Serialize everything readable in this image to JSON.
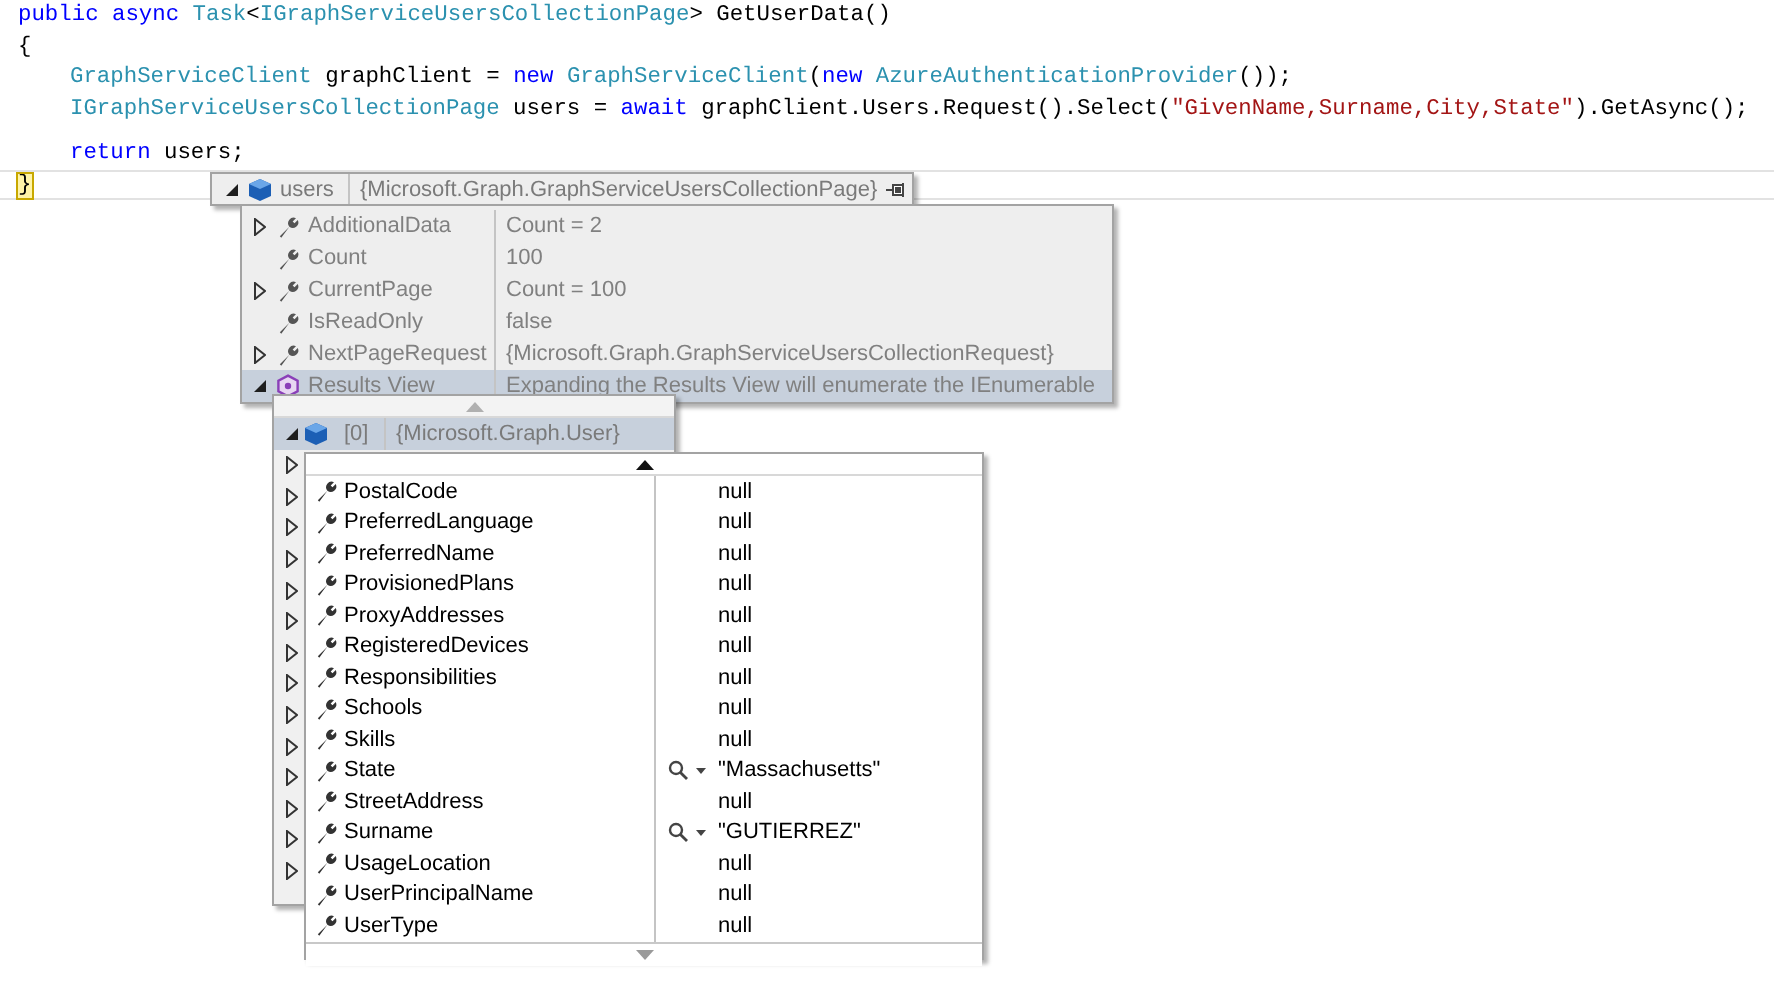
{
  "code": {
    "lines": [
      {
        "kind": "code",
        "indent": false,
        "current": false,
        "tokens": [
          {
            "kind": "keyword",
            "text": "public async "
          },
          {
            "kind": "type",
            "text": "Task"
          },
          {
            "kind": "plain",
            "text": "<"
          },
          {
            "kind": "type",
            "text": "IGraphServiceUsersCollectionPage"
          },
          {
            "kind": "plain",
            "text": "> GetUserData()"
          }
        ]
      },
      {
        "kind": "code",
        "indent": false,
        "current": false,
        "tokens": [
          {
            "kind": "plain",
            "text": "{"
          }
        ]
      },
      {
        "kind": "code",
        "indent": true,
        "current": false,
        "tokens": [
          {
            "kind": "type",
            "text": "GraphServiceClient"
          },
          {
            "kind": "plain",
            "text": " graphClient = "
          },
          {
            "kind": "keyword",
            "text": "new "
          },
          {
            "kind": "type",
            "text": "GraphServiceClient"
          },
          {
            "kind": "plain",
            "text": "("
          },
          {
            "kind": "keyword",
            "text": "new "
          },
          {
            "kind": "type",
            "text": "AzureAuthenticationProvider"
          },
          {
            "kind": "plain",
            "text": "());"
          }
        ]
      },
      {
        "kind": "code",
        "indent": true,
        "current": false,
        "tokens": [
          {
            "kind": "type",
            "text": "IGraphServiceUsersCollectionPage"
          },
          {
            "kind": "plain",
            "text": " users = "
          },
          {
            "kind": "keyword",
            "text": "await "
          },
          {
            "kind": "plain",
            "text": "graphClient.Users.Request().Select("
          },
          {
            "kind": "string",
            "text": "\"GivenName,Surname,City,State\""
          },
          {
            "kind": "plain",
            "text": ").GetAsync();"
          }
        ]
      },
      {
        "kind": "blank"
      },
      {
        "kind": "code",
        "indent": true,
        "current": false,
        "tokens": [
          {
            "kind": "keyword",
            "text": "return "
          },
          {
            "kind": "plain",
            "text": "users;"
          }
        ]
      },
      {
        "kind": "code",
        "indent": false,
        "current": true,
        "tokens": [
          {
            "kind": "match",
            "text": "}"
          }
        ]
      }
    ]
  },
  "datatip": {
    "name": "users",
    "value": "{Microsoft.Graph.GraphServiceUsersCollectionPage}",
    "expanded": true,
    "children": [
      {
        "kind": "property",
        "name": "AdditionalData",
        "value": "Count = 2",
        "expanded": false,
        "selected": false
      },
      {
        "kind": "property",
        "name": "Count",
        "value": "100",
        "selected": false
      },
      {
        "kind": "property",
        "name": "CurrentPage",
        "value": "Count = 100",
        "expanded": false,
        "selected": false
      },
      {
        "kind": "property",
        "name": "IsReadOnly",
        "value": "false",
        "selected": false
      },
      {
        "kind": "property",
        "name": "NextPageRequest",
        "value": "{Microsoft.Graph.GraphServiceUsersCollectionRequest}",
        "expanded": false,
        "selected": false
      },
      {
        "kind": "results",
        "name": "Results View",
        "value": "Expanding the Results View will enumerate the IEnumerable",
        "expanded": true,
        "selected": true
      }
    ]
  },
  "results": {
    "items": [
      {
        "kind": "object",
        "name": "[0]",
        "value": "{Microsoft.Graph.User}",
        "expanded": true,
        "selected": true
      },
      {
        "kind": "hidden",
        "expanded": false,
        "selected": false
      },
      {
        "kind": "hidden",
        "expanded": false,
        "selected": false
      },
      {
        "kind": "hidden",
        "expanded": false,
        "selected": false
      },
      {
        "kind": "hidden",
        "expanded": false,
        "selected": false
      },
      {
        "kind": "hidden",
        "expanded": false,
        "selected": false
      },
      {
        "kind": "hidden",
        "expanded": false,
        "selected": false
      },
      {
        "kind": "hidden",
        "expanded": false,
        "selected": false
      },
      {
        "kind": "hidden",
        "expanded": false,
        "selected": false
      },
      {
        "kind": "hidden",
        "expanded": false,
        "selected": false
      },
      {
        "kind": "hidden",
        "expanded": false,
        "selected": false
      },
      {
        "kind": "hidden",
        "expanded": false,
        "selected": false
      },
      {
        "kind": "hidden",
        "expanded": false,
        "selected": false
      },
      {
        "kind": "hidden",
        "expanded": false,
        "selected": false
      },
      {
        "kind": "hidden",
        "expanded": false,
        "selected": false
      }
    ]
  },
  "user_members": [
    {
      "name": "PostalCode",
      "value": "null",
      "visualizer": false
    },
    {
      "name": "PreferredLanguage",
      "value": "null",
      "visualizer": false
    },
    {
      "name": "PreferredName",
      "value": "null",
      "visualizer": false
    },
    {
      "name": "ProvisionedPlans",
      "value": "null",
      "visualizer": false
    },
    {
      "name": "ProxyAddresses",
      "value": "null",
      "visualizer": false
    },
    {
      "name": "RegisteredDevices",
      "value": "null",
      "visualizer": false
    },
    {
      "name": "Responsibilities",
      "value": "null",
      "visualizer": false
    },
    {
      "name": "Schools",
      "value": "null",
      "visualizer": false
    },
    {
      "name": "Skills",
      "value": "null",
      "visualizer": false
    },
    {
      "name": "State",
      "value": "\"Massachusetts\"",
      "visualizer": true
    },
    {
      "name": "StreetAddress",
      "value": "null",
      "visualizer": false
    },
    {
      "name": "Surname",
      "value": "\"GUTIERREZ\"",
      "visualizer": true
    },
    {
      "name": "UsageLocation",
      "value": "null",
      "visualizer": false
    },
    {
      "name": "UserPrincipalName",
      "value": "null",
      "visualizer": false
    },
    {
      "name": "UserType",
      "value": "null",
      "visualizer": false
    }
  ]
}
